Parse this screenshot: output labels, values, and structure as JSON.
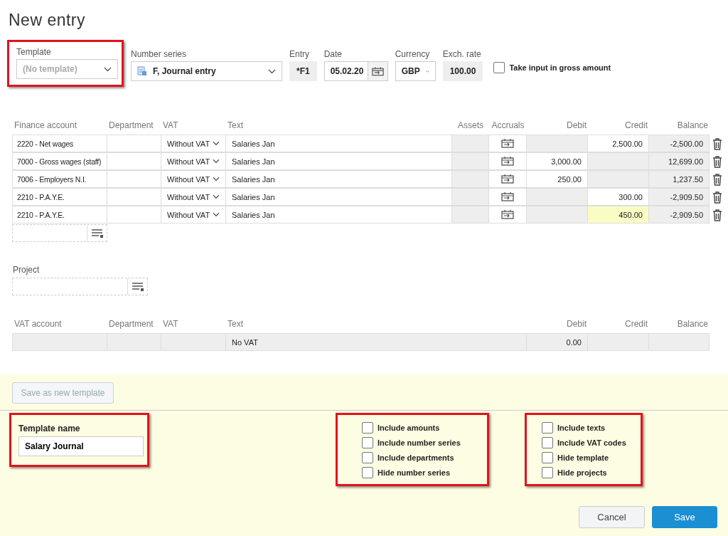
{
  "title": "New entry",
  "header_fields": {
    "template": {
      "label": "Template",
      "placeholder": "(No template)",
      "highlighted": true
    },
    "number_series": {
      "label": "Number series",
      "value": "F, Journal entry"
    },
    "entry": {
      "label": "Entry",
      "value": "*F1"
    },
    "date": {
      "label": "Date",
      "value": "05.02.20"
    },
    "currency": {
      "label": "Currency",
      "value": "GBP"
    },
    "exch_rate": {
      "label": "Exch. rate",
      "value": "100.00"
    },
    "gross": {
      "label": "Take input in gross amount",
      "checked": false
    }
  },
  "entries_table": {
    "columns": [
      "Finance account",
      "Department",
      "VAT",
      "Text",
      "Assets",
      "Accruals",
      "Debit",
      "Credit",
      "Balance"
    ],
    "rows": [
      {
        "account": "2220 - Net wages",
        "vat": "Without VAT",
        "text": "Salaries Jan",
        "debit": "",
        "credit": "2,500.00",
        "balance": "-2,500.00",
        "focused": false
      },
      {
        "account": "7000 - Gross wages (staff)",
        "vat": "Without VAT",
        "text": "Salaries Jan",
        "debit": "3,000.00",
        "credit": "",
        "balance": "12,699.00",
        "focused": false
      },
      {
        "account": "7006 - Employers N.I.",
        "vat": "Without VAT",
        "text": "Salaries Jan",
        "debit": "250.00",
        "credit": "",
        "balance": "1,237.50",
        "focused": false
      },
      {
        "account": "2210 - P.A.Y.E.",
        "vat": "Without VAT",
        "text": "Salaries Jan",
        "debit": "",
        "credit": "300.00",
        "balance": "-2,909.50",
        "focused": false
      },
      {
        "account": "2210 - P.A.Y.E.",
        "vat": "Without VAT",
        "text": "Salaries Jan",
        "debit": "",
        "credit": "450.00",
        "balance": "-2,909.50",
        "focused": true
      }
    ]
  },
  "project": {
    "label": "Project"
  },
  "vat_table": {
    "columns": [
      "VAT account",
      "Department",
      "VAT",
      "Text",
      "Debit",
      "Credit",
      "Balance"
    ],
    "rows": [
      {
        "text": "No VAT",
        "debit": "0.00"
      }
    ]
  },
  "save_template_button": {
    "label": "Save as new template",
    "disabled": true
  },
  "template_name": {
    "label": "Template name",
    "value": "Salary Journal",
    "highlighted": true
  },
  "option_groups": [
    {
      "highlighted": true,
      "items": [
        {
          "label": "Include amounts",
          "checked": false
        },
        {
          "label": "Include number series",
          "checked": false
        },
        {
          "label": "Include departments",
          "checked": false
        },
        {
          "label": "Hide number series",
          "checked": false
        }
      ]
    },
    {
      "highlighted": true,
      "items": [
        {
          "label": "Include texts",
          "checked": false
        },
        {
          "label": "Include VAT codes",
          "checked": false
        },
        {
          "label": "Hide template",
          "checked": false
        },
        {
          "label": "Hide projects",
          "checked": false
        }
      ]
    }
  ],
  "buttons": [
    {
      "label": "Cancel",
      "kind": "secondary"
    },
    {
      "label": "Save",
      "kind": "primary"
    }
  ]
}
